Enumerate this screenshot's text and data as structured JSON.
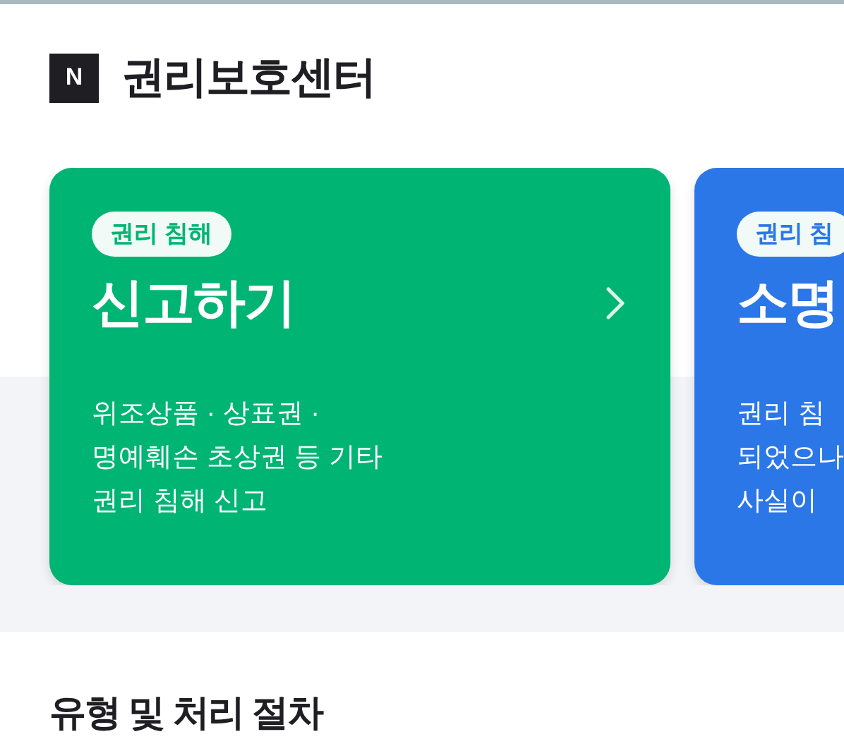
{
  "header": {
    "logo": "N",
    "title": "권리보호센터"
  },
  "cards": [
    {
      "tag": "권리 침해",
      "title": "신고하기",
      "arrow": true,
      "color": "#00b473",
      "lines": [
        "위조상품 · 상표권 ·",
        "명예훼손 초상권 등 기타",
        "권리 침해 신고"
      ]
    },
    {
      "tag": "권리 침",
      "title": "소명",
      "arrow": false,
      "color": "#2b77e8",
      "lines": [
        "권리 침",
        "되었으나",
        "사실이"
      ]
    }
  ],
  "section": {
    "title": "유형 및 처리 절차"
  }
}
